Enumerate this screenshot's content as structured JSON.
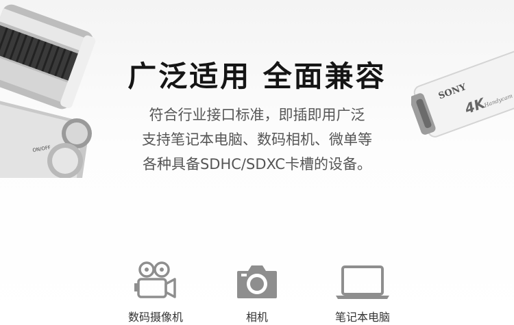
{
  "headline": "广泛适用 全面兼容",
  "description_lines": [
    "符合行业接口标准，即插即用广泛",
    "支持笔记本电脑、数码相机、微单等",
    "各种具备SDHC/SDXC卡槽的设备。"
  ],
  "left_camera": {
    "dial_label": "ON/OFF"
  },
  "camcorder": {
    "brand_text": "SONY",
    "model_text": "4K",
    "script_text": "Handycam"
  },
  "devices": [
    {
      "label": "数码摄像机",
      "icon": "video-camera-icon"
    },
    {
      "label": "相机",
      "icon": "camera-icon"
    },
    {
      "label": "笔记本电脑",
      "icon": "laptop-icon"
    }
  ],
  "colors": {
    "icon_gray": "#8e8e8e",
    "title": "#151515",
    "body_text": "#555555"
  }
}
